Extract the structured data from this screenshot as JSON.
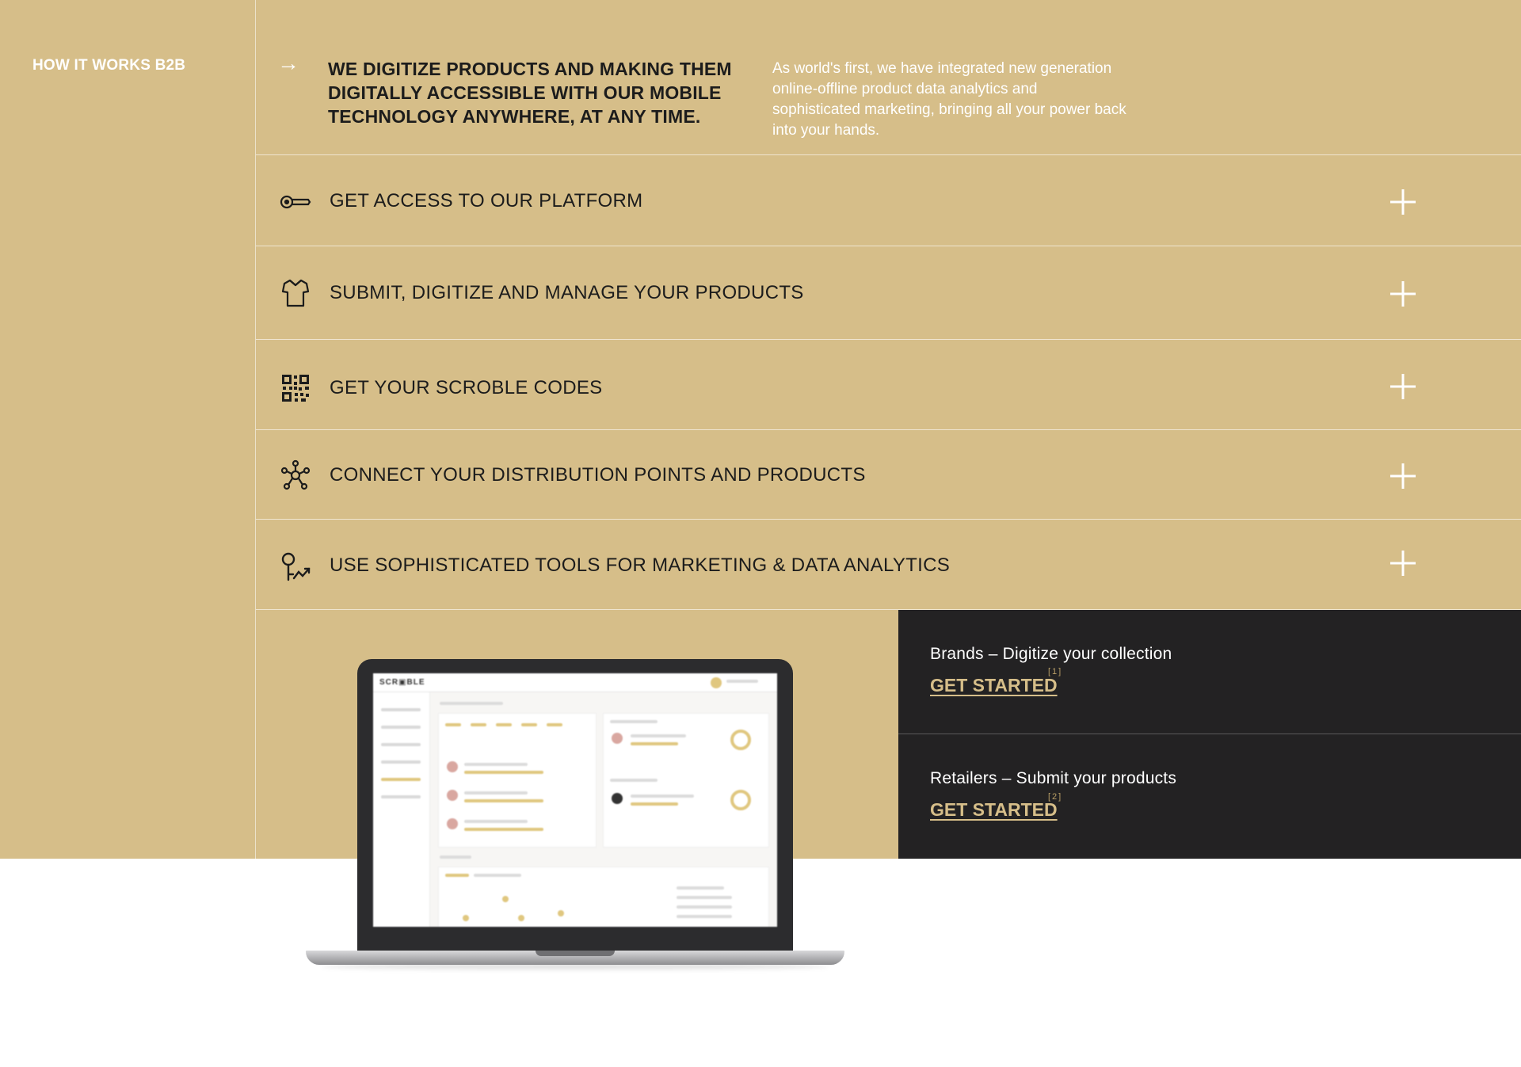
{
  "section": {
    "label": "HOW IT WORKS B2B"
  },
  "intro": {
    "arrow": "→",
    "title": "WE DIGITIZE PRODUCTS AND MAKING THEM DIGITALLY ACCESSIBLE WITH OUR MOBILE TECHNOLOGY ANYWHERE, AT ANY TIME.",
    "description": "As world's first, we have integrated new generation online-offline product data analytics and sophisticated marketing, bringing all your power back into your hands."
  },
  "features": [
    {
      "label": "GET ACCESS TO OUR PLATFORM",
      "icon": "key-icon"
    },
    {
      "label": "SUBMIT, DIGITIZE AND MANAGE YOUR PRODUCTS",
      "icon": "shirt-icon"
    },
    {
      "label": "GET YOUR SCROBLE CODES",
      "icon": "qr-code-icon"
    },
    {
      "label": "CONNECT YOUR DISTRIBUTION POINTS AND PRODUCTS",
      "icon": "network-icon"
    },
    {
      "label": "USE SOPHISTICATED TOOLS FOR MARKETING & DATA ANALYTICS",
      "icon": "analytics-icon"
    }
  ],
  "cta": {
    "brands": {
      "text": "Brands – Digitize your collection",
      "link": "GET STARTED",
      "ref": "[1]"
    },
    "retailers": {
      "text": "Retailers – Submit your products",
      "link": "GET STARTED",
      "ref": "[2]"
    }
  },
  "colors": {
    "gold": "#d6be89",
    "dark": "#232223",
    "text": "#1c1c1c"
  }
}
